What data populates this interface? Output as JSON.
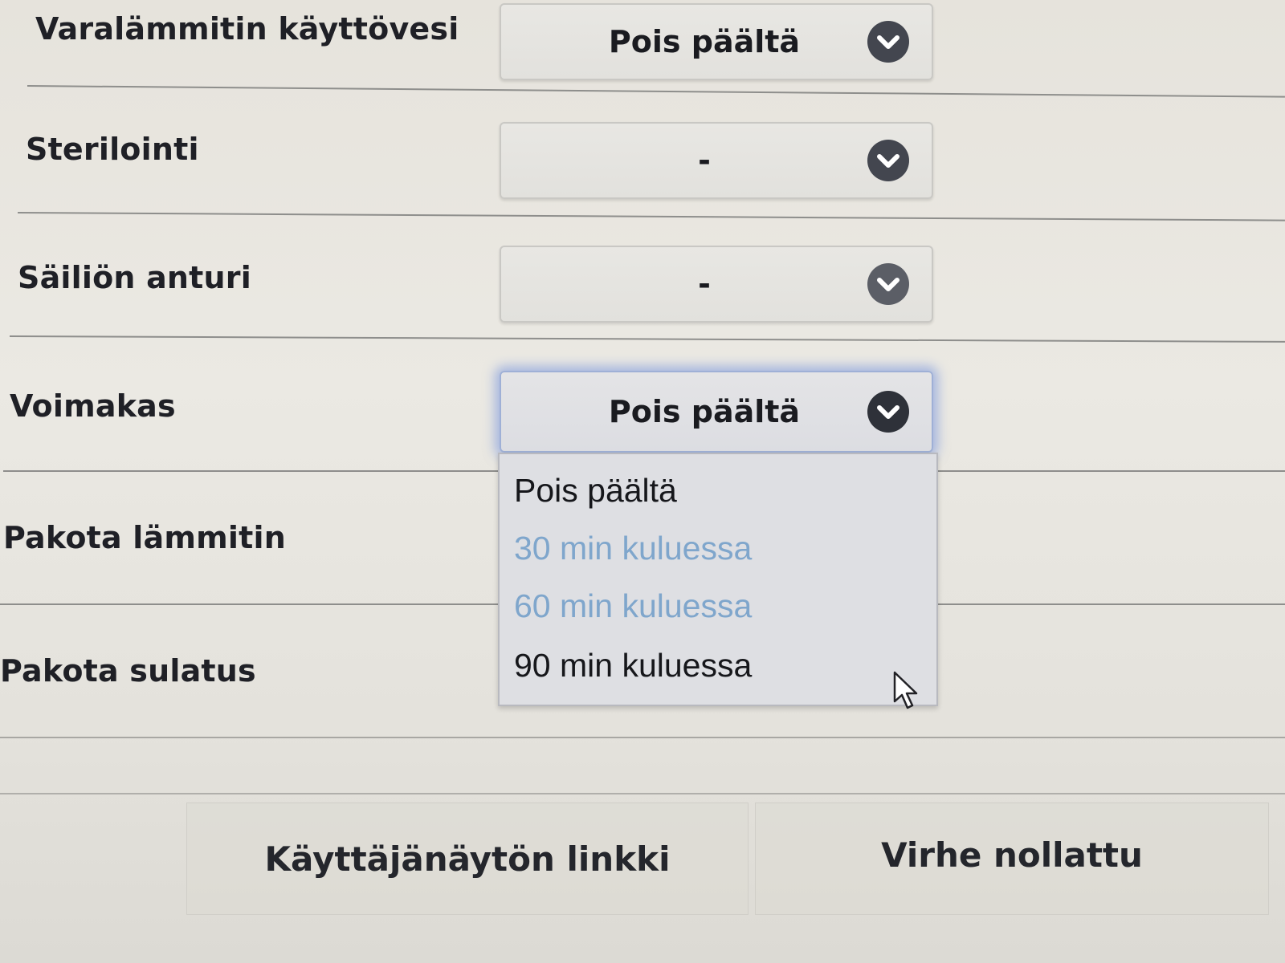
{
  "rows": [
    {
      "label": "Varalämmitin käyttövesi",
      "value": "Pois päältä"
    },
    {
      "label": "Sterilointi",
      "value": "-"
    },
    {
      "label": "Säiliön anturi",
      "value": "-"
    },
    {
      "label": "Voimakas",
      "value": "Pois päältä"
    },
    {
      "label": "Pakota lämmitin"
    },
    {
      "label": "Pakota sulatus"
    }
  ],
  "dropdown": {
    "options": [
      {
        "label": "Pois päältä",
        "state": "enabled"
      },
      {
        "label": "30 min kuluessa",
        "state": "disabled"
      },
      {
        "label": "60 min kuluessa",
        "state": "disabled"
      },
      {
        "label": "90 min kuluessa",
        "state": "enabled"
      }
    ]
  },
  "buttons": {
    "user_link": "Käyttäjänäytön linkki",
    "error_reset": "Virhe nollattu"
  },
  "icons": {
    "select_toggle": "chevron-down-icon",
    "pointer": "mouse-cursor-icon"
  },
  "colors": {
    "focus_glow": "#6e8cdc",
    "disabled_option": "#7fa6cc",
    "chevron_bg": "#43464f"
  }
}
